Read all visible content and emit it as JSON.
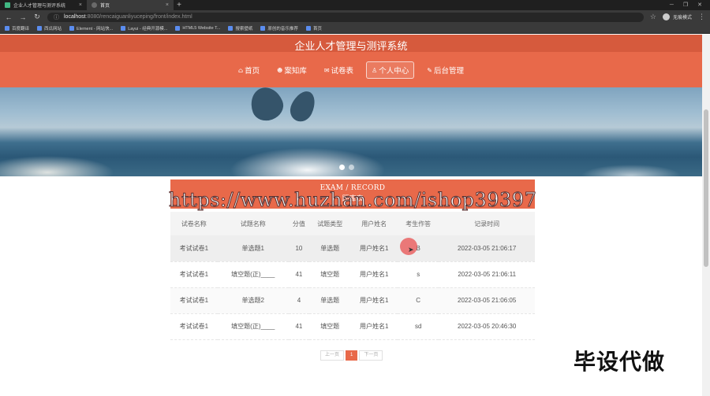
{
  "browser": {
    "tabs": [
      {
        "title": "企业人才管理与测评系统",
        "active": false
      },
      {
        "title": "首页",
        "active": true
      }
    ],
    "url_host": "localhost",
    "url_path": ":8080/rencaiguanliyuceping/front/index.html",
    "profile_label": "无痕模式",
    "bookmarks": [
      "百度翻译",
      "西瓜网站",
      "Element - 网站快...",
      "Layui - 经典开源模...",
      "HTML5 Website T...",
      "搜索壁纸",
      "原创的音乐推荐",
      "首页"
    ]
  },
  "header": {
    "site_title": "企业人才管理与测评系统",
    "menu": [
      {
        "icon": "⌂",
        "label": "首页",
        "active": false
      },
      {
        "icon": "☻",
        "label": "案知库",
        "active": false
      },
      {
        "icon": "✉",
        "label": "试卷表",
        "active": false
      },
      {
        "icon": "♙",
        "label": "个人中心",
        "active": true
      },
      {
        "icon": "✎",
        "label": "后台管理",
        "active": false
      }
    ]
  },
  "banner": {
    "slide_count": 2,
    "active_slide": 1
  },
  "record": {
    "title_en": "EXAM / RECORD",
    "title_cn": "题库表",
    "columns": [
      "试卷名称",
      "试题名称",
      "分值",
      "试题类型",
      "用户姓名",
      "考生作答",
      "记录时间"
    ],
    "rows": [
      [
        "考试试卷1",
        "单选题1",
        "10",
        "单选题",
        "用户姓名1",
        "B",
        "2022-03-05 21:06:17"
      ],
      [
        "考试试卷1",
        "填空题(正)____",
        "41",
        "填空题",
        "用户姓名1",
        "s",
        "2022-03-05 21:06:11"
      ],
      [
        "考试试卷1",
        "单选题2",
        "4",
        "单选题",
        "用户姓名1",
        "C",
        "2022-03-05 21:06:05"
      ],
      [
        "考试试卷1",
        "填空题(正)____",
        "41",
        "填空题",
        "用户姓名1",
        "sd",
        "2022-03-05 20:46:30"
      ]
    ]
  },
  "pagination": {
    "prev": "上一页",
    "current": "1",
    "next": "下一页"
  },
  "overlay": {
    "watermark_url": "https://www.huzhan.com/ishop39397",
    "watermark_text": "毕设代做"
  }
}
